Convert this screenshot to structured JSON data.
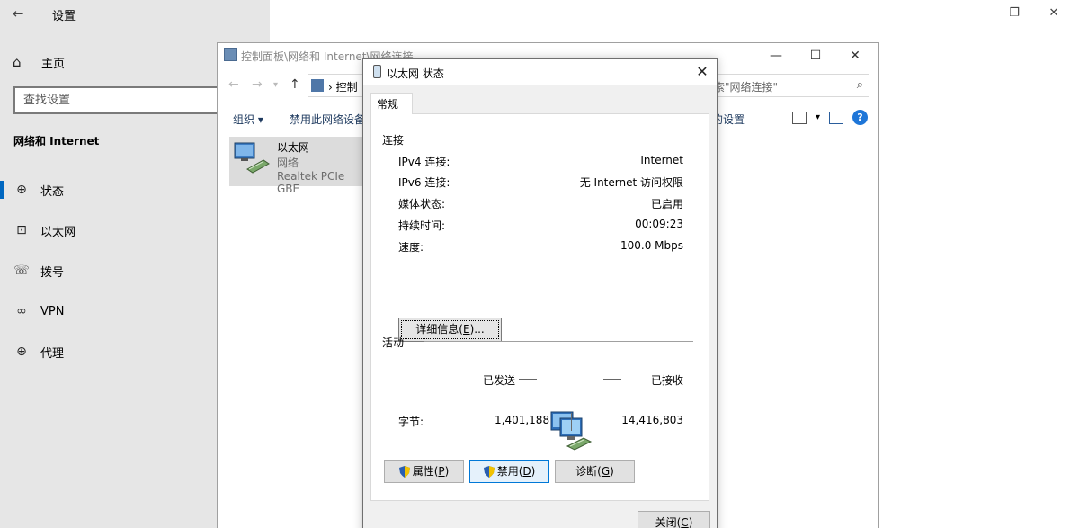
{
  "settings": {
    "title": "设置",
    "home_label": "主页",
    "search_placeholder": "查找设置",
    "section_title": "网络和 Internet",
    "nav": [
      {
        "label": "状态",
        "icon": "globe-icon"
      },
      {
        "label": "以太网",
        "icon": "ethernet-icon"
      },
      {
        "label": "拨号",
        "icon": "dialup-icon"
      },
      {
        "label": "VPN",
        "icon": "vpn-icon"
      },
      {
        "label": "代理",
        "icon": "proxy-globe-icon"
      }
    ]
  },
  "net_connections": {
    "title": "控制面板\\网络和 Internet\\网络连接",
    "address_text": "控制",
    "search_placeholder": "搜索\"网络连接\"",
    "toolbar": {
      "organize": "组织",
      "disable": "禁用此网络设备",
      "settings": "的设置"
    },
    "adapter": {
      "name": "以太网",
      "network": "网络",
      "device": "Realtek PCIe GBE"
    }
  },
  "dialog": {
    "title": "以太网 状态",
    "tab": "常规",
    "connection_group": "连接",
    "rows": [
      {
        "key": "IPv4 连接:",
        "value": "Internet"
      },
      {
        "key": "IPv6 连接:",
        "value": "无 Internet 访问权限"
      },
      {
        "key": "媒体状态:",
        "value": "已启用"
      },
      {
        "key": "持续时间:",
        "value": "00:09:23"
      },
      {
        "key": "速度:",
        "value": "100.0 Mbps"
      }
    ],
    "details_button": {
      "label": "详细信息(",
      "accel": "E",
      "suffix": ")..."
    },
    "activity_group": "活动",
    "sent_label": "已发送",
    "received_label": "已接收",
    "bytes_label": "字节:",
    "bytes_sent": "1,401,188",
    "bytes_received": "14,416,803",
    "buttons": {
      "properties": {
        "label": "属性(",
        "accel": "P",
        "suffix": ")"
      },
      "disable": {
        "label": "禁用(",
        "accel": "D",
        "suffix": ")"
      },
      "diagnose": {
        "label": "诊断(",
        "accel": "G",
        "suffix": ")"
      },
      "close": {
        "label": "关闭(",
        "accel": "C",
        "suffix": ")"
      }
    }
  }
}
